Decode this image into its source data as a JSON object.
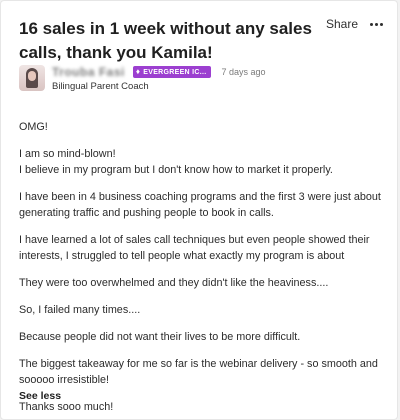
{
  "post": {
    "title": "16 sales in 1 week without any sales calls, thank you Kamila!",
    "share_label": "Share",
    "more_icon": "more-dots-icon",
    "author": {
      "name": "Trouba Fasi",
      "badge": "EVERGREEN IC...",
      "badge_icon": "gem-icon",
      "badge_color": "#9c3fd0",
      "time": "7 days ago",
      "role": "Bilingual Parent Coach"
    },
    "paragraphs": [
      "OMG!",
      "I am so mind-blown!\nI believe in my program but I don't know how to market it properly.",
      "I have been in 4 business coaching programs and the first 3 were just about generating traffic and pushing people to book in calls.",
      "I have learned a lot of sales call techniques but even people showed their interests, I struggled to tell people what exactly my program is about",
      "They were too overwhelmed and they didn't like the heaviness....",
      "So, I failed many times....",
      "Because people did not want their lives to be more difficult.",
      "The biggest takeaway for me so far is the webinar delivery - so smooth and sooooo irresistible!",
      "Thanks sooo much!"
    ],
    "see_less_label": "See less"
  }
}
